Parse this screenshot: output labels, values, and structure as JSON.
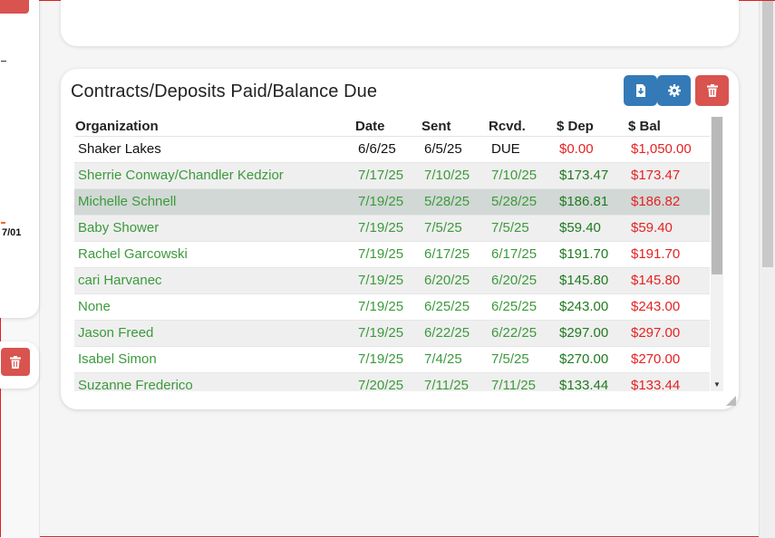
{
  "left_fragment": "7/01",
  "widget": {
    "title": "Contracts/Deposits Paid/Balance Due",
    "buttons": {
      "download_icon": "download-icon",
      "settings_icon": "gear-icon",
      "delete_icon": "trash-icon"
    }
  },
  "table": {
    "columns": [
      "Organization",
      "Date",
      "Sent",
      "Rcvd.",
      "$ Dep",
      "$ Bal"
    ],
    "rows": [
      {
        "org": "Shaker Lakes",
        "date": "6/6/25",
        "sent": "6/5/25",
        "rcvd": "DUE",
        "dep": "$0.00",
        "bal": "$1,050.00"
      },
      {
        "org": "Sherrie Conway/Chandler Kedzior",
        "date": "7/17/25",
        "sent": "7/10/25",
        "rcvd": "7/10/25",
        "dep": "$173.47",
        "bal": "$173.47"
      },
      {
        "org": "Michelle Schnell",
        "date": "7/19/25",
        "sent": "5/28/25",
        "rcvd": "5/28/25",
        "dep": "$186.81",
        "bal": "$186.82"
      },
      {
        "org": "Baby Shower",
        "date": "7/19/25",
        "sent": "7/5/25",
        "rcvd": "7/5/25",
        "dep": "$59.40",
        "bal": "$59.40"
      },
      {
        "org": "Rachel Garcowski",
        "date": "7/19/25",
        "sent": "6/17/25",
        "rcvd": "6/17/25",
        "dep": "$191.70",
        "bal": "$191.70"
      },
      {
        "org": "cari Harvanec",
        "date": "7/19/25",
        "sent": "6/20/25",
        "rcvd": "6/20/25",
        "dep": "$145.80",
        "bal": "$145.80"
      },
      {
        "org": "None",
        "date": "7/19/25",
        "sent": "6/25/25",
        "rcvd": "6/25/25",
        "dep": "$243.00",
        "bal": "$243.00"
      },
      {
        "org": "Jason Freed",
        "date": "7/19/25",
        "sent": "6/22/25",
        "rcvd": "6/22/25",
        "dep": "$297.00",
        "bal": "$297.00"
      },
      {
        "org": "Isabel Simon",
        "date": "7/19/25",
        "sent": "7/4/25",
        "rcvd": "7/5/25",
        "dep": "$270.00",
        "bal": "$270.00"
      },
      {
        "org": "Suzanne Frederico",
        "date": "7/20/25",
        "sent": "7/11/25",
        "rcvd": "7/11/25",
        "dep": "$133.44",
        "bal": "$133.44"
      }
    ]
  },
  "colors": {
    "primary_button": "#337ab7",
    "danger_button": "#d9534f",
    "received_text": "#3c9a3c",
    "deposit_text": "#1f7a1f",
    "balance_text": "#e52222",
    "selected_row": "#d1d8d5"
  }
}
